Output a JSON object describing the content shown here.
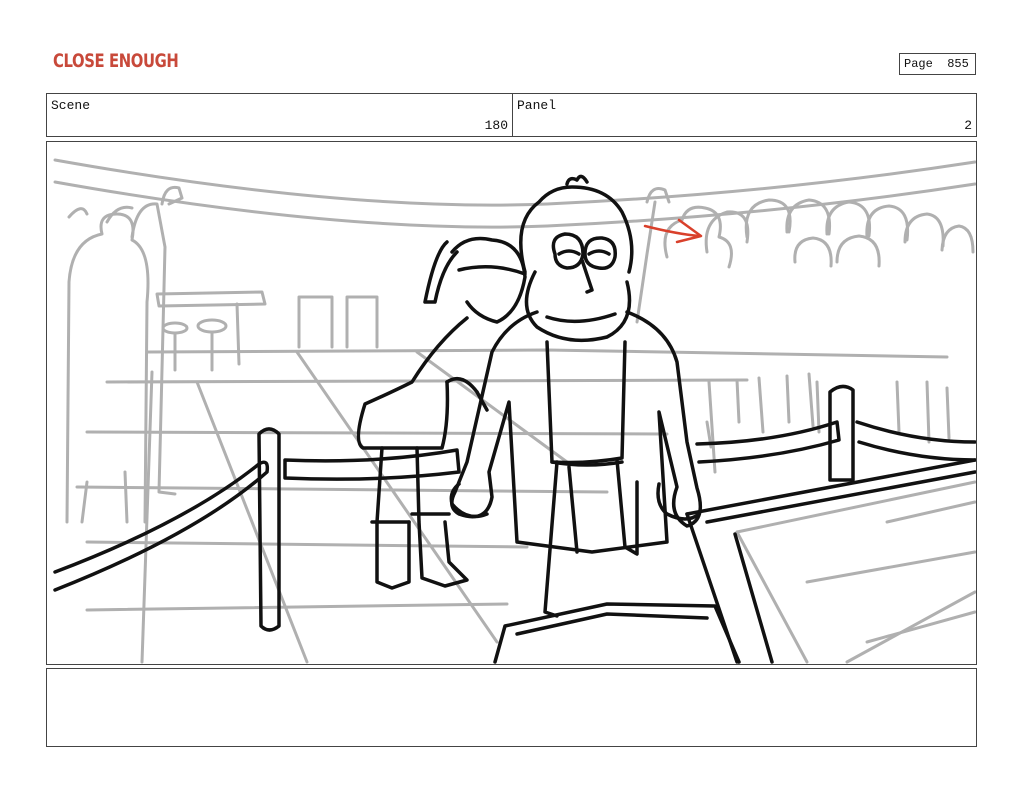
{
  "header": {
    "logo_text": "CLOSE ENOUGH",
    "page_label": "Page",
    "page_number": "855"
  },
  "scene": {
    "label": "Scene",
    "value": "180"
  },
  "panel": {
    "label": "Panel",
    "value": "2"
  },
  "drawing": {
    "description_icon": "storyboard-sketch",
    "colors": {
      "ink": "#111111",
      "background_sketch": "#b0b0b0",
      "arrow": "#d9402b",
      "logo": "#c8493a"
    }
  },
  "notes": {
    "text": ""
  }
}
